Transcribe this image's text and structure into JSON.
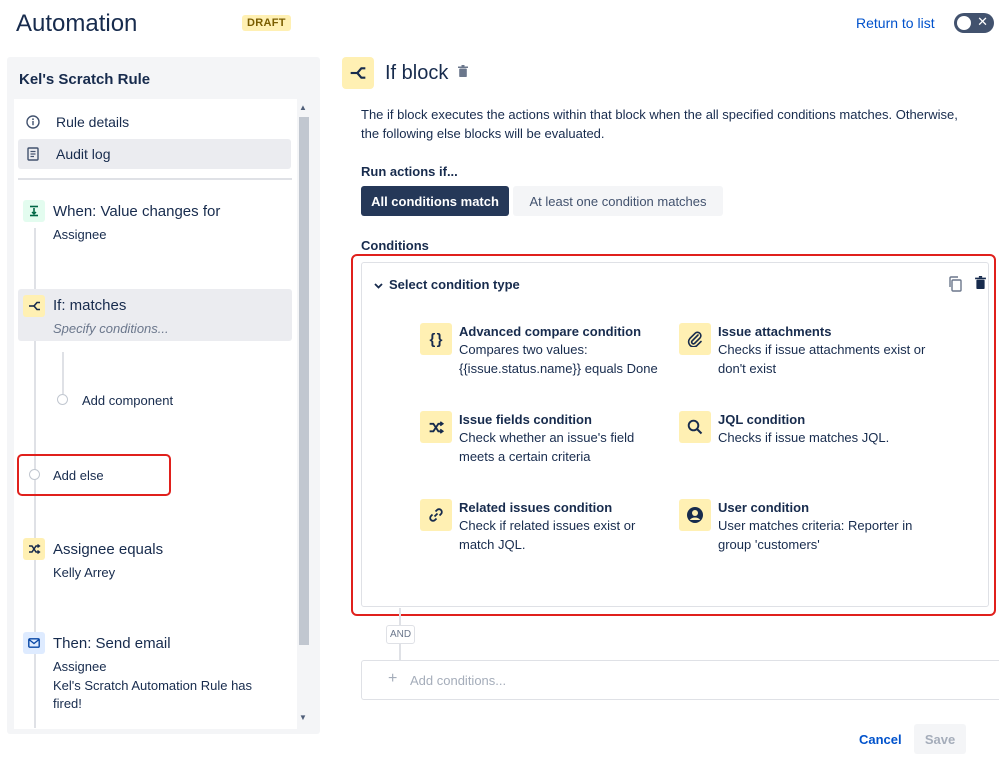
{
  "header": {
    "title": "Automation",
    "badge": "DRAFT",
    "return_link": "Return to list"
  },
  "sidebar": {
    "rule_name": "Kel's Scratch Rule",
    "menu": [
      {
        "label": "Rule details",
        "icon": "info-icon"
      },
      {
        "label": "Audit log",
        "icon": "document-icon"
      }
    ],
    "components": [
      {
        "title": "When: Value changes for",
        "subtitle": "Assignee",
        "icon": "trigger-icon",
        "color": "#e3fcef"
      },
      {
        "title": "If: matches",
        "subtitle": "Specify conditions...",
        "icon": "branch-icon",
        "color": "#fff0b3"
      },
      {
        "title": "Assignee equals",
        "subtitle": "Kelly Arrey",
        "icon": "shuffle-icon",
        "color": "#fff0b3"
      },
      {
        "title": "Then: Send email",
        "subtitle": "Assignee",
        "subtitle2": "Kel's Scratch Automation Rule has fired!",
        "icon": "email-icon",
        "color": "#deebff"
      }
    ],
    "add_component": "Add component",
    "add_else": "Add else"
  },
  "main": {
    "block_title": "If block",
    "description": "The if block executes the actions within that block when the all specified conditions matches. Otherwise, the following else blocks will be evaluated.",
    "run_label": "Run actions if...",
    "run_options": [
      "All conditions match",
      "At least one condition matches"
    ],
    "run_selected": "All conditions match",
    "conditions_label": "Conditions",
    "select_type": "Select condition type",
    "options": [
      {
        "title": "Advanced compare condition",
        "desc": "Compares two values: {{issue.status.name}} equals Done",
        "icon": "braces-icon"
      },
      {
        "title": "Issue attachments",
        "desc": "Checks if issue attachments exist or don't exist",
        "icon": "paperclip-icon"
      },
      {
        "title": "Issue fields condition",
        "desc": "Check whether an issue's field meets a certain criteria",
        "icon": "shuffle-icon"
      },
      {
        "title": "JQL condition",
        "desc": "Checks if issue matches JQL.",
        "icon": "search-icon"
      },
      {
        "title": "Related issues condition",
        "desc": "Check if related issues exist or match JQL.",
        "icon": "link-icon"
      },
      {
        "title": "User condition",
        "desc": "User matches criteria: Reporter in group 'customers'",
        "icon": "user-icon"
      }
    ],
    "and_label": "AND",
    "add_conditions": "Add conditions...",
    "cancel": "Cancel",
    "save": "Save"
  },
  "colors": {
    "accent": "#0052cc",
    "dark_button": "#253858",
    "highlight": "#e0201c",
    "condition_icon_bg": "#fff0b3"
  }
}
